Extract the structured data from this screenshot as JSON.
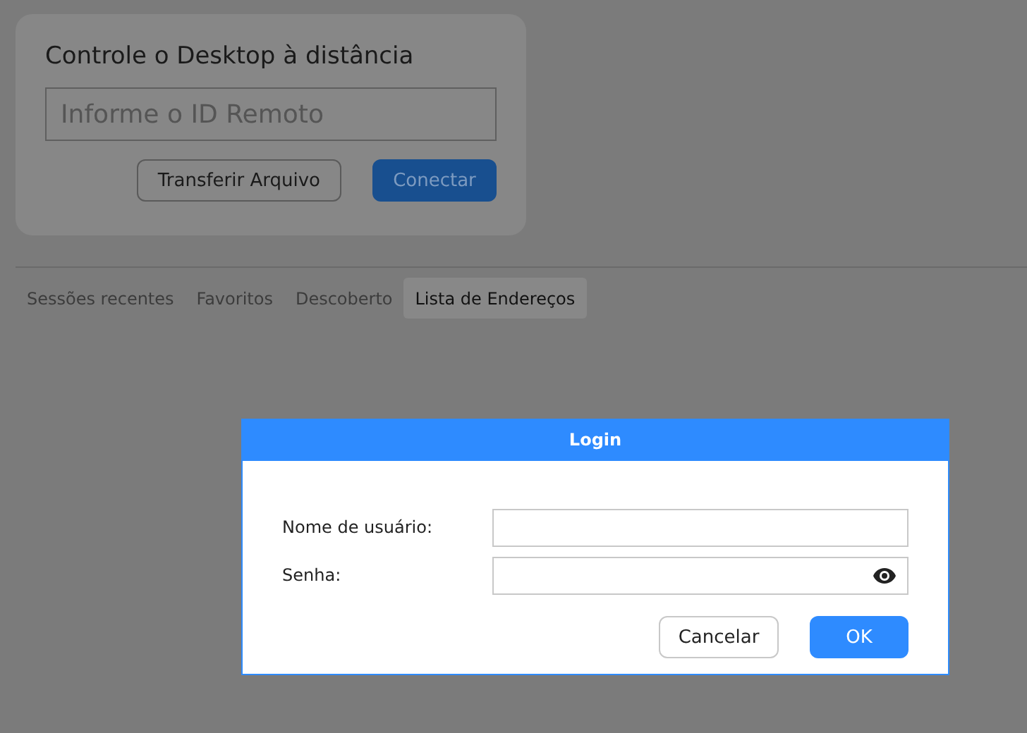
{
  "remote_card": {
    "title": "Controle o Desktop à distância",
    "id_field": {
      "placeholder": "Informe o ID Remoto"
    },
    "buttons": [
      {
        "label": "Transferir Arquivo",
        "kind": "secondary"
      },
      {
        "label": "Conectar",
        "kind": "primary"
      }
    ]
  },
  "tabs": [
    {
      "label": "Sessões recentes",
      "selected": false
    },
    {
      "label": "Favoritos",
      "selected": false
    },
    {
      "label": "Descoberto",
      "selected": false
    },
    {
      "label": "Lista de Endereços",
      "selected": true
    }
  ],
  "dialog": {
    "title": "Login",
    "fields": [
      {
        "label": "Nome de usuário:",
        "kind": "text"
      },
      {
        "label": "Senha:",
        "kind": "password"
      }
    ],
    "buttons": [
      {
        "label": "Cancelar",
        "kind": "secondary"
      },
      {
        "label": "OK",
        "kind": "primary"
      }
    ]
  }
}
